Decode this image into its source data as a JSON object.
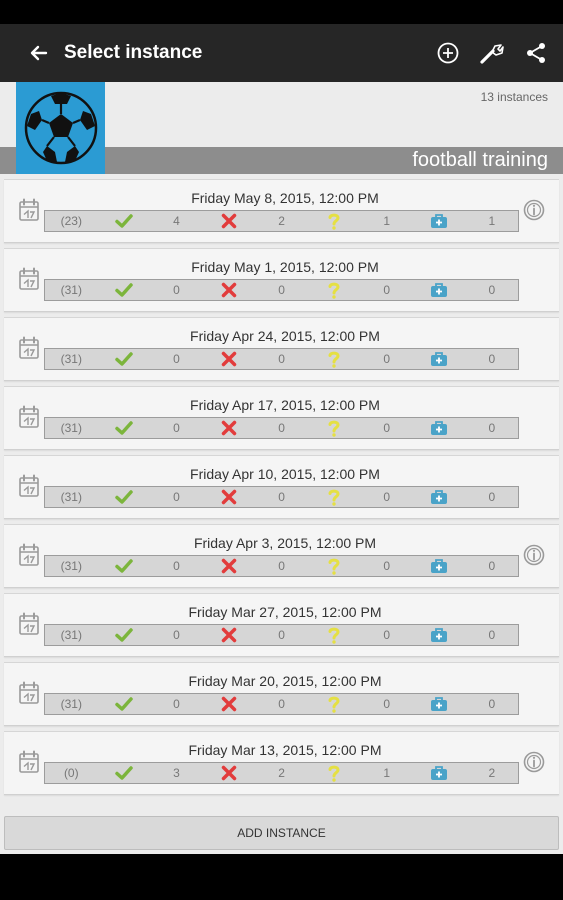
{
  "appbar": {
    "title": "Select instance",
    "icons": [
      "back-arrow-icon",
      "add-circle-icon",
      "wrench-icon",
      "share-icon"
    ]
  },
  "header": {
    "instance_count": "13 instances",
    "activity_name": "football training",
    "logo_icon": "soccer-ball-icon",
    "logo_color": "#2b9bd3"
  },
  "colors": {
    "present": "#7cb53c",
    "absent": "#e23c3c",
    "maybe": "#e5e043",
    "excused": "#4aa3c8"
  },
  "instances": [
    {
      "date": "Friday May 8, 2015, 12:00 PM",
      "total": "(23)",
      "yes": "4",
      "no": "2",
      "maybe": "1",
      "excused": "1",
      "has_info": true
    },
    {
      "date": "Friday May 1, 2015, 12:00 PM",
      "total": "(31)",
      "yes": "0",
      "no": "0",
      "maybe": "0",
      "excused": "0",
      "has_info": false
    },
    {
      "date": "Friday Apr 24, 2015, 12:00 PM",
      "total": "(31)",
      "yes": "0",
      "no": "0",
      "maybe": "0",
      "excused": "0",
      "has_info": false
    },
    {
      "date": "Friday Apr 17, 2015, 12:00 PM",
      "total": "(31)",
      "yes": "0",
      "no": "0",
      "maybe": "0",
      "excused": "0",
      "has_info": false
    },
    {
      "date": "Friday Apr 10, 2015, 12:00 PM",
      "total": "(31)",
      "yes": "0",
      "no": "0",
      "maybe": "0",
      "excused": "0",
      "has_info": false
    },
    {
      "date": "Friday Apr 3, 2015, 12:00 PM",
      "total": "(31)",
      "yes": "0",
      "no": "0",
      "maybe": "0",
      "excused": "0",
      "has_info": true
    },
    {
      "date": "Friday Mar 27, 2015, 12:00 PM",
      "total": "(31)",
      "yes": "0",
      "no": "0",
      "maybe": "0",
      "excused": "0",
      "has_info": false
    },
    {
      "date": "Friday Mar 20, 2015, 12:00 PM",
      "total": "(31)",
      "yes": "0",
      "no": "0",
      "maybe": "0",
      "excused": "0",
      "has_info": false
    },
    {
      "date": "Friday Mar 13, 2015, 12:00 PM",
      "total": "(0)",
      "yes": "3",
      "no": "2",
      "maybe": "1",
      "excused": "2",
      "has_info": true
    }
  ],
  "add_button": "ADD INSTANCE"
}
